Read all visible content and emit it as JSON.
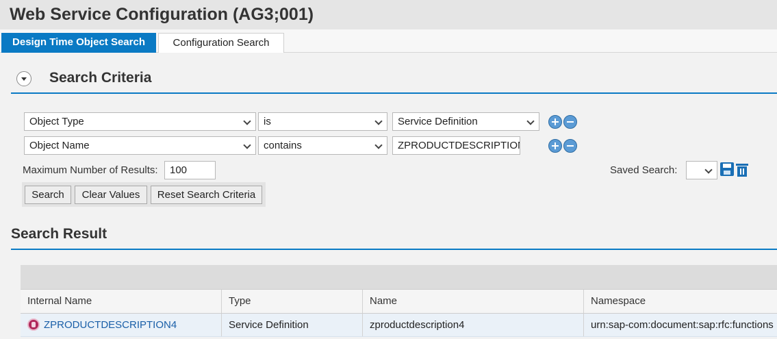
{
  "window": {
    "title": "Web Service Configuration (AG3;001)"
  },
  "tabs": [
    {
      "label": "Design Time Object Search",
      "active": true
    },
    {
      "label": "Configuration Search",
      "active": false
    }
  ],
  "search_criteria": {
    "title": "Search Criteria",
    "rows": [
      {
        "field": "Object Type",
        "operator": "is",
        "value": "Service Definition"
      },
      {
        "field": "Object Name",
        "operator": "contains",
        "value": "ZPRODUCTDESCRIPTION"
      }
    ],
    "max_results_label": "Maximum Number of Results:",
    "max_results_value": "100",
    "saved_search_label": "Saved Search:",
    "buttons": {
      "search": "Search",
      "clear": "Clear Values",
      "reset": "Reset Search Criteria"
    }
  },
  "search_result": {
    "title": "Search Result",
    "columns": [
      "Internal Name",
      "Type",
      "Name",
      "Namespace"
    ],
    "rows": [
      {
        "internal_name": "ZPRODUCTDESCRIPTION4",
        "type": "Service Definition",
        "name": "zproductdescription4",
        "namespace": "urn:sap-com:document:sap:rfc:functions"
      }
    ]
  },
  "colors": {
    "accent": "#0a7ac4",
    "link": "#1a5fa8"
  }
}
